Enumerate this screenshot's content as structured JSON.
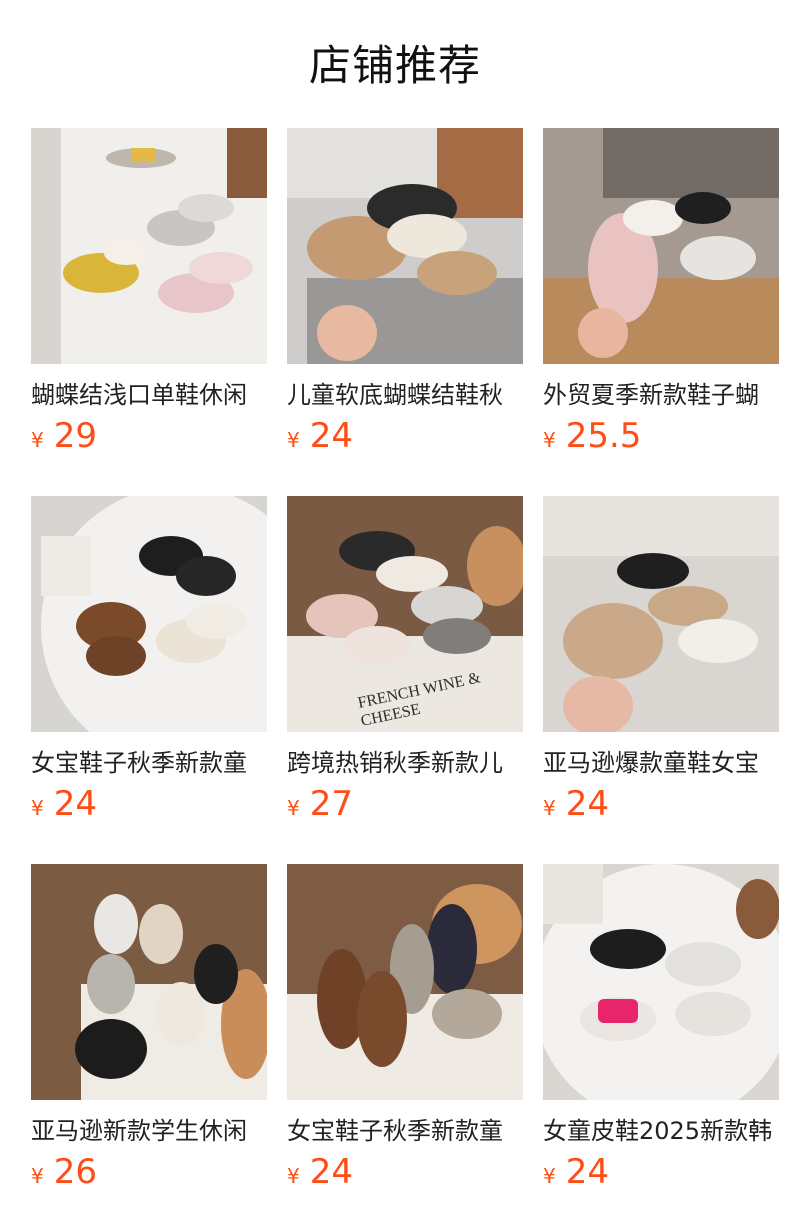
{
  "header": {
    "title": "店铺推荐"
  },
  "currency": "¥",
  "products": [
    {
      "name": "蝴蝶结浅口单鞋休闲",
      "price": "29",
      "image_icon": "shoes-photo-icon"
    },
    {
      "name": "儿童软底蝴蝶结鞋秋",
      "price": "24",
      "image_icon": "shoes-photo-icon"
    },
    {
      "name": "外贸夏季新款鞋子蝴",
      "price": "25.5",
      "image_icon": "shoes-photo-icon"
    },
    {
      "name": "女宝鞋子秋季新款童",
      "price": "24",
      "image_icon": "shoes-photo-icon"
    },
    {
      "name": "跨境热销秋季新款儿",
      "price": "27",
      "image_icon": "shoes-photo-icon",
      "photo_text": [
        "FRENCH WINE &",
        "CHEESE"
      ]
    },
    {
      "name": "亚马逊爆款童鞋女宝",
      "price": "24",
      "image_icon": "shoes-photo-icon"
    },
    {
      "name": "亚马逊新款学生休闲",
      "price": "26",
      "image_icon": "shoes-photo-icon"
    },
    {
      "name": "女宝鞋子秋季新款童",
      "price": "24",
      "image_icon": "shoes-photo-icon"
    },
    {
      "name": "女童皮鞋2025新款韩",
      "price": "24",
      "image_icon": "shoes-photo-icon"
    }
  ],
  "colors": {
    "price": "#ff4d17",
    "title": "#111111",
    "name": "#222222"
  }
}
